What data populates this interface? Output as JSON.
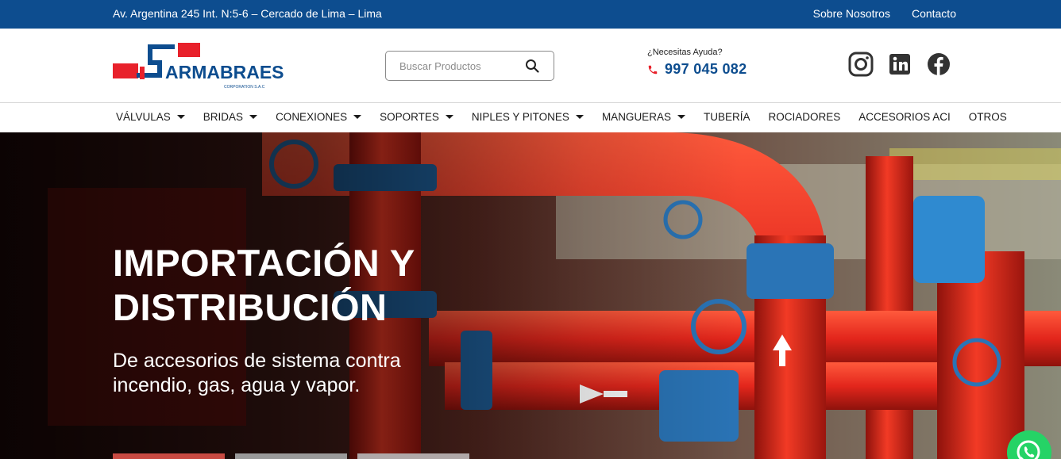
{
  "topbar": {
    "address": "Av. Argentina 245 Int. N:5-6 – Cercado de Lima – Lima",
    "links": [
      "Sobre Nosotros",
      "Contacto"
    ]
  },
  "header": {
    "logo_text": "ARMABRAES",
    "logo_subtext": "CORPORATION S.A.C",
    "search_placeholder": "Buscar Productos",
    "help_label": "¿Necesitas Ayuda?",
    "phone": "997 045 082",
    "social_icons": [
      "instagram-icon",
      "linkedin-icon",
      "facebook-icon"
    ]
  },
  "nav": {
    "items": [
      {
        "label": "VÁLVULAS",
        "dropdown": true
      },
      {
        "label": "BRIDAS",
        "dropdown": true
      },
      {
        "label": "CONEXIONES",
        "dropdown": true
      },
      {
        "label": "SOPORTES",
        "dropdown": true
      },
      {
        "label": "NIPLES Y PITONES",
        "dropdown": true
      },
      {
        "label": "MANGUERAS",
        "dropdown": true
      },
      {
        "label": "TUBERÍA",
        "dropdown": false
      },
      {
        "label": "ROCIADORES",
        "dropdown": false
      },
      {
        "label": "ACCESORIOS ACI",
        "dropdown": false
      },
      {
        "label": "OTROS",
        "dropdown": false
      }
    ]
  },
  "hero": {
    "title": "IMPORTACIÓN Y DISTRIBUCIÓN",
    "subtitle": "De accesorios de sistema contra incendio, gas, agua y vapor."
  },
  "colors": {
    "brand_blue": "#0d4d8f",
    "brand_red": "#e8212b",
    "whatsapp_green": "#25d366"
  }
}
